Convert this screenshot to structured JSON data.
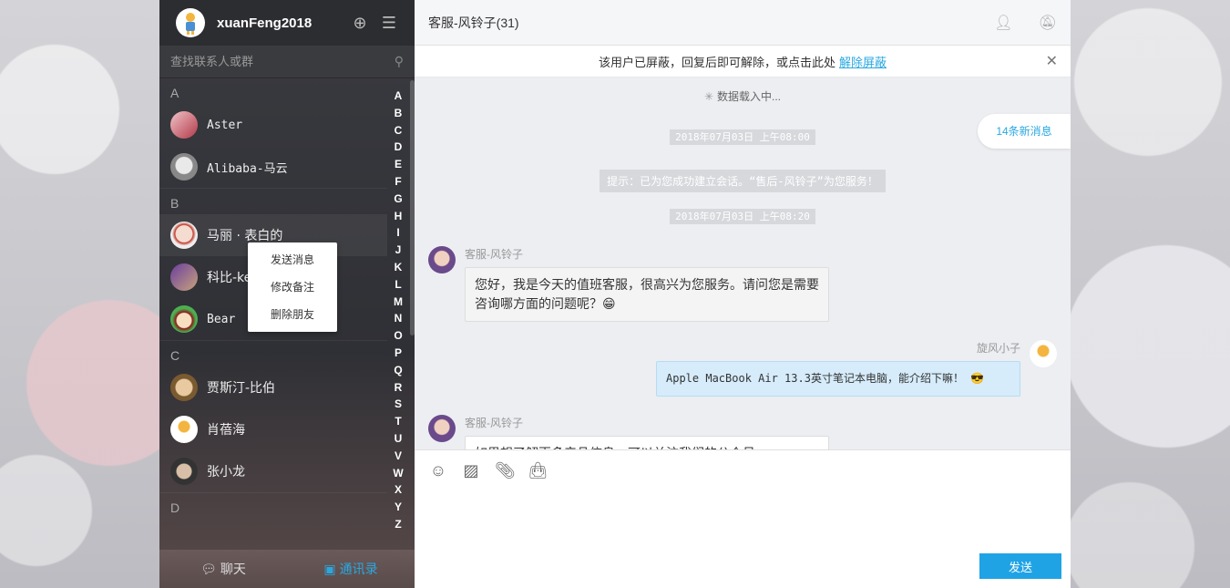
{
  "user": {
    "name": "xuanFeng2018"
  },
  "header_icons": {
    "add": "plus-circle-icon",
    "menu": "list-icon"
  },
  "search": {
    "placeholder": "查找联系人或群"
  },
  "groups": [
    {
      "letter": "A",
      "contacts": [
        "Aster",
        "Alibaba-马云"
      ]
    },
    {
      "letter": "B",
      "contacts": [
        "马丽 · 表白的",
        "科比-ke",
        "Bear"
      ]
    },
    {
      "letter": "C",
      "contacts": [
        "贾斯汀-比伯",
        "肖蓓海",
        "张小龙"
      ]
    },
    {
      "letter": "D",
      "contacts": []
    }
  ],
  "alphabet": [
    "A",
    "B",
    "C",
    "D",
    "E",
    "F",
    "G",
    "H",
    "I",
    "J",
    "K",
    "L",
    "M",
    "N",
    "O",
    "P",
    "Q",
    "R",
    "S",
    "T",
    "U",
    "V",
    "W",
    "X",
    "Y",
    "Z"
  ],
  "context_menu": [
    "发送消息",
    "修改备注",
    "删除朋友"
  ],
  "footer_tabs": {
    "chat": "聊天",
    "contacts": "通讯录"
  },
  "chat": {
    "title": "客服-风铃子(31)",
    "notice_text": "该用户已屏蔽，回复后即可解除，或点击此处",
    "notice_link": "解除屏蔽",
    "loading": "数据载入中...",
    "new_messages": "14条新消息",
    "time1": "2018年07月03日 上午08:00",
    "tip": "提示：已为您成功建立会话。“售后-风铃子”为您服务！",
    "time2": "2018年07月03日 上午08:20",
    "msg1_name": "客服-风铃子",
    "msg1_text": "您好，我是今天的值班客服，很高兴为您服务。请问您是需要咨询哪方面的问题呢？😁",
    "msg2_name": "旋风小子",
    "msg2_text": "Apple MacBook Air 13.3英寸笔记本电脑，能介绍下嘛！ 😎",
    "msg3_name": "客服-风铃子",
    "msg3_text": "如果想了解更多产品信息，可以关注我们的公众号"
  },
  "composer": {
    "send": "发送"
  }
}
